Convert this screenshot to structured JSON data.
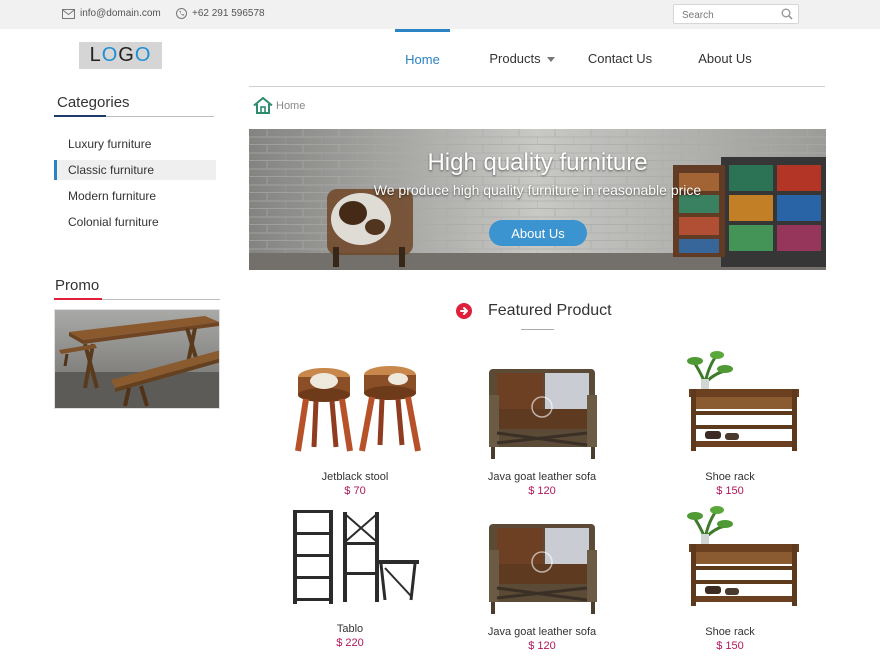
{
  "topbar": {
    "email": "info@domain.com",
    "phone": "+62 291 596578",
    "search_placeholder": "Search"
  },
  "logo": {
    "letters": [
      "L",
      "O",
      "G",
      "O"
    ]
  },
  "nav": {
    "items": [
      {
        "label": "Home",
        "active": true
      },
      {
        "label": "Products",
        "has_dropdown": true
      },
      {
        "label": "Contact Us"
      },
      {
        "label": "About Us"
      }
    ]
  },
  "sidebar": {
    "categories_title": "Categories",
    "categories": [
      {
        "label": "Luxury furniture"
      },
      {
        "label": "Classic furniture",
        "active": true
      },
      {
        "label": "Modern furniture"
      },
      {
        "label": "Colonial furniture"
      }
    ],
    "promo_title": "Promo"
  },
  "breadcrumb": {
    "label": "Home"
  },
  "hero": {
    "title": "High quality furniture",
    "subtitle": "We produce high quality furniture in reasonable price",
    "button": "About Us"
  },
  "featured": {
    "title": "Featured Product",
    "products": [
      {
        "name": "Jetblack stool",
        "price": "$ 70",
        "image": "stools"
      },
      {
        "name": "Java goat leather sofa",
        "price": "$ 120",
        "image": "sofa"
      },
      {
        "name": "Shoe rack",
        "price": "$ 150",
        "image": "rack"
      },
      {
        "name": "Tablo",
        "price": "$ 220",
        "image": "shelf"
      },
      {
        "name": "Java goat leather sofa",
        "price": "$ 120",
        "image": "sofa"
      },
      {
        "name": "Shoe rack",
        "price": "$ 150",
        "image": "rack"
      }
    ]
  },
  "colors": {
    "accent_blue": "#2a84c4",
    "price_magenta": "#b0175a",
    "promo_accent_red": "#e0203a",
    "category_accent_navy": "#1e3a6b"
  }
}
